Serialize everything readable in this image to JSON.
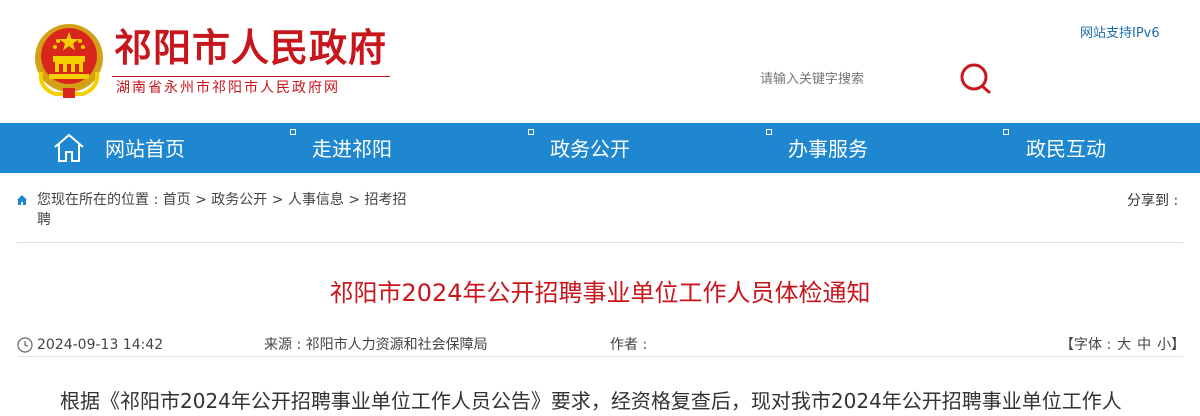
{
  "header": {
    "site_title": "祁阳市人民政府",
    "site_subtitle": "湖南省永州市祁阳市人民政府网",
    "ipv6_link": "网站支持IPv6",
    "search_placeholder": "请输入关键字搜索",
    "search_icon": "search-icon"
  },
  "nav": {
    "items": [
      {
        "label": "网站首页",
        "icon": "home-icon"
      },
      {
        "label": "走进祁阳"
      },
      {
        "label": "政务公开"
      },
      {
        "label": "办事服务"
      },
      {
        "label": "政民互动"
      }
    ]
  },
  "breadcrumb": {
    "prefix": "您现在所在的位置 : ",
    "items": [
      "首页",
      "政务公开",
      "人事信息",
      "招考招聘"
    ],
    "separator": " > "
  },
  "share_label": "分享到 :",
  "article": {
    "title": "祁阳市2024年公开招聘事业单位工作人员体检通知",
    "date": "2024-09-13 14:42",
    "source_label": "来源 :",
    "source": "祁阳市人力资源和社会保障局",
    "author_label": "作者 :",
    "author": "",
    "font_label": "【字体 :",
    "font_sizes": [
      "大",
      "中",
      "小"
    ],
    "font_close": "】",
    "body_first_line": "根据《祁阳市2024年公开招聘事业单位工作人员公告》要求，经资格复查后，现对我市2024年公开招聘事业单位工作人"
  },
  "colors": {
    "brand_red": "#c8161d",
    "nav_blue": "#1e87cf",
    "link_blue": "#1a6fb0"
  }
}
